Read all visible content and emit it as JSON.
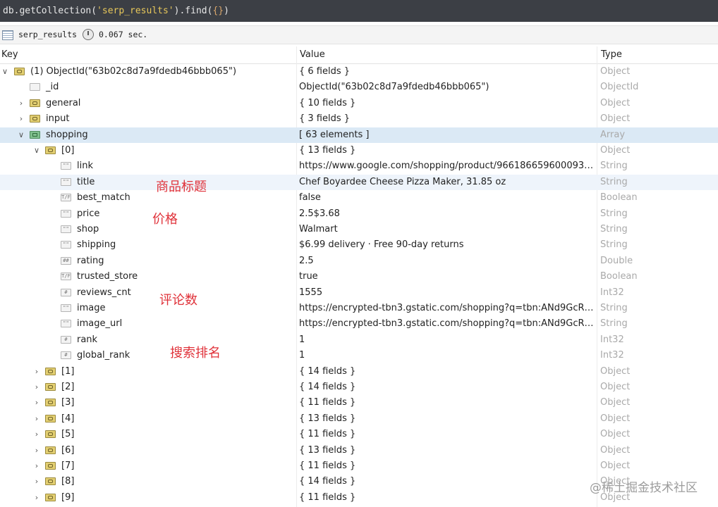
{
  "command": {
    "prefix": "db.getCollection(",
    "collection_arg": "'serp_results'",
    "middle": ").find(",
    "query": "{}",
    "suffix": ")"
  },
  "info": {
    "collection": "serp_results",
    "time": "0.067 sec."
  },
  "headers": {
    "key": "Key",
    "value": "Value",
    "type": "Type"
  },
  "rows": [
    {
      "arrow": "∨",
      "icon": "obj",
      "icon_name": "object-icon",
      "key": "(1) ObjectId(\"63b02c8d7a9fdedb46bbb065\")",
      "value": "{ 6 fields }",
      "type": "Object"
    },
    {
      "arrow": "",
      "icon": "oid",
      "icon_name": "objectid-icon",
      "key": "_id",
      "value": "ObjectId(\"63b02c8d7a9fdedb46bbb065\")",
      "type": "ObjectId"
    },
    {
      "arrow": "›",
      "icon": "obj",
      "icon_name": "object-icon",
      "key": "general",
      "value": "{ 10 fields }",
      "type": "Object"
    },
    {
      "arrow": "›",
      "icon": "obj",
      "icon_name": "object-icon",
      "key": "input",
      "value": "{ 3 fields }",
      "type": "Object"
    },
    {
      "arrow": "∨",
      "icon": "arr",
      "icon_name": "array-icon",
      "key": "shopping",
      "value": "[ 63 elements ]",
      "type": "Array"
    },
    {
      "arrow": "∨",
      "icon": "obj",
      "icon_name": "object-icon",
      "key": "[0]",
      "value": "{ 13 fields }",
      "type": "Object"
    },
    {
      "arrow": "",
      "icon": "str",
      "icon_name": "string-icon",
      "key": "link",
      "value": "https://www.google.com/shopping/product/96618665960009308...",
      "type": "String"
    },
    {
      "arrow": "",
      "icon": "str",
      "icon_name": "string-icon",
      "key": "title",
      "value": "Chef Boyardee Cheese Pizza Maker, 31.85 oz",
      "type": "String"
    },
    {
      "arrow": "",
      "icon": "bool",
      "icon_name": "boolean-icon",
      "key": "best_match",
      "value": "false",
      "type": "Boolean"
    },
    {
      "arrow": "",
      "icon": "str",
      "icon_name": "string-icon",
      "key": "price",
      "value": "2.5$3.68",
      "type": "String"
    },
    {
      "arrow": "",
      "icon": "str",
      "icon_name": "string-icon",
      "key": "shop",
      "value": "Walmart",
      "type": "String"
    },
    {
      "arrow": "",
      "icon": "str",
      "icon_name": "string-icon",
      "key": "shipping",
      "value": "$6.99 delivery · Free 90-day returns",
      "type": "String"
    },
    {
      "arrow": "",
      "icon": "dbl",
      "icon_name": "double-icon",
      "key": "rating",
      "value": "2.5",
      "type": "Double"
    },
    {
      "arrow": "",
      "icon": "bool",
      "icon_name": "boolean-icon",
      "key": "trusted_store",
      "value": "true",
      "type": "Boolean"
    },
    {
      "arrow": "",
      "icon": "num",
      "icon_name": "int32-icon",
      "key": "reviews_cnt",
      "value": "1555",
      "type": "Int32"
    },
    {
      "arrow": "",
      "icon": "str",
      "icon_name": "string-icon",
      "key": "image",
      "value": "https://encrypted-tbn3.gstatic.com/shopping?q=tbn:ANd9GcRkZC...",
      "type": "String"
    },
    {
      "arrow": "",
      "icon": "str",
      "icon_name": "string-icon",
      "key": "image_url",
      "value": "https://encrypted-tbn3.gstatic.com/shopping?q=tbn:ANd9GcRkZC...",
      "type": "String"
    },
    {
      "arrow": "",
      "icon": "num",
      "icon_name": "int32-icon",
      "key": "rank",
      "value": "1",
      "type": "Int32"
    },
    {
      "arrow": "",
      "icon": "num",
      "icon_name": "int32-icon",
      "key": "global_rank",
      "value": "1",
      "type": "Int32"
    },
    {
      "arrow": "›",
      "icon": "obj",
      "icon_name": "object-icon",
      "key": "[1]",
      "value": "{ 14 fields }",
      "type": "Object"
    },
    {
      "arrow": "›",
      "icon": "obj",
      "icon_name": "object-icon",
      "key": "[2]",
      "value": "{ 14 fields }",
      "type": "Object"
    },
    {
      "arrow": "›",
      "icon": "obj",
      "icon_name": "object-icon",
      "key": "[3]",
      "value": "{ 11 fields }",
      "type": "Object"
    },
    {
      "arrow": "›",
      "icon": "obj",
      "icon_name": "object-icon",
      "key": "[4]",
      "value": "{ 13 fields }",
      "type": "Object"
    },
    {
      "arrow": "›",
      "icon": "obj",
      "icon_name": "object-icon",
      "key": "[5]",
      "value": "{ 11 fields }",
      "type": "Object"
    },
    {
      "arrow": "›",
      "icon": "obj",
      "icon_name": "object-icon",
      "key": "[6]",
      "value": "{ 13 fields }",
      "type": "Object"
    },
    {
      "arrow": "›",
      "icon": "obj",
      "icon_name": "object-icon",
      "key": "[7]",
      "value": "{ 11 fields }",
      "type": "Object"
    },
    {
      "arrow": "›",
      "icon": "obj",
      "icon_name": "object-icon",
      "key": "[8]",
      "value": "{ 14 fields }",
      "type": "Object"
    },
    {
      "arrow": "›",
      "icon": "obj",
      "icon_name": "object-icon",
      "key": "[9]",
      "value": "{ 11 fields }",
      "type": "Object"
    }
  ],
  "annotations": {
    "title_note": "商品标题",
    "price_note": "价格",
    "reviews_note": "评论数",
    "rank_note": "搜索排名"
  },
  "watermark": "@稀土掘金技术社区",
  "colors": {
    "command_bar_bg": "#3c3f45",
    "selected_row": "#dbe9f5",
    "annotation": "#e0323a",
    "type_text": "#a9a9a9"
  }
}
